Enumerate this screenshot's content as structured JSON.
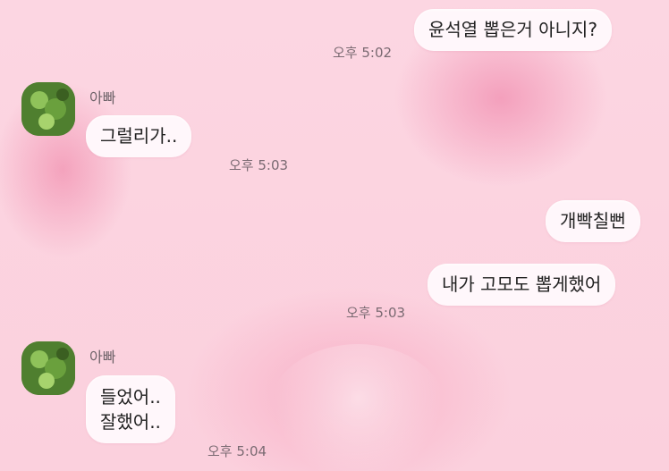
{
  "messages": [
    {
      "side": "right",
      "text": "윤석열 뽑은거 아니지?",
      "time": "오후 5:02"
    },
    {
      "side": "left",
      "sender": "아빠",
      "text": "그럴리가..",
      "time": "오후 5:03"
    },
    {
      "side": "right",
      "text": "개빡칠뻔"
    },
    {
      "side": "right",
      "text": "내가 고모도 뽑게했어",
      "time": "오후 5:03"
    },
    {
      "side": "left",
      "sender": "아빠",
      "lines": [
        "들었어..",
        "잘했어.."
      ],
      "time": "오후 5:04"
    }
  ],
  "theme": {
    "background": "#fbd3df",
    "bubble": "#fff7fb"
  }
}
